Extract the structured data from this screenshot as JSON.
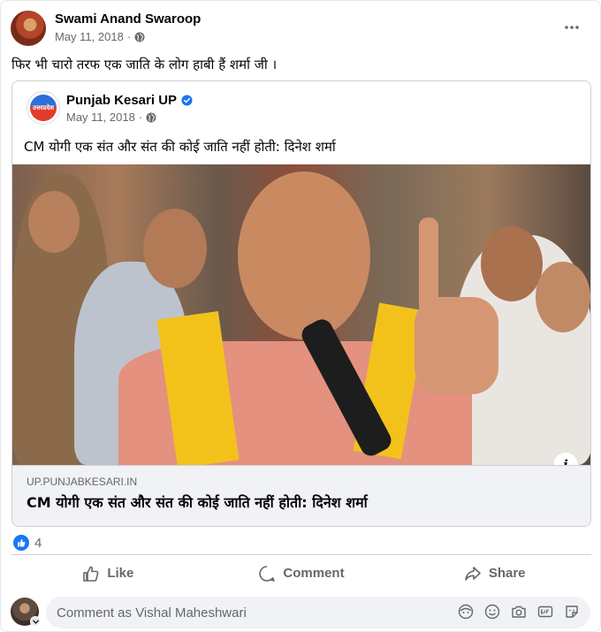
{
  "post": {
    "author": "Swami Anand Swaroop",
    "date": "May 11, 2018",
    "date_separator": "·",
    "text": "फिर भी चारो तरफ एक जाति के लोग हाबी हैं शर्मा जी ।"
  },
  "shared": {
    "page_name": "Punjab Kesari UP",
    "date": "May 11, 2018",
    "date_separator": "·",
    "text": "CM योगी एक संत और संत की कोई जाति नहीं होती: दिनेश शर्मा",
    "logo_text": "उत्तरप्रदेश",
    "info_icon_glyph": "i",
    "link_domain": "UP.PUNJABKESARI.IN",
    "link_title": "CM योगी एक संत और संत की कोई जाति नहीं होती: दिनेश शर्मा"
  },
  "reactions": {
    "count": "4"
  },
  "actions": {
    "like": "Like",
    "comment": "Comment",
    "share": "Share"
  },
  "comment_box": {
    "placeholder": "Comment as Vishal Maheshwari"
  },
  "colors": {
    "brand_blue": "#1877f2",
    "secondary_text": "#65676b",
    "divider": "#ced0d4",
    "input_bg": "#f0f2f5"
  },
  "icons": [
    "globe-icon",
    "more-options-icon",
    "verified-badge-icon",
    "like-reaction-icon",
    "like-icon",
    "comment-icon",
    "share-icon",
    "info-icon",
    "avatar-sticker-icon",
    "emoji-icon",
    "camera-icon",
    "gif-icon",
    "sticker-icon"
  ]
}
